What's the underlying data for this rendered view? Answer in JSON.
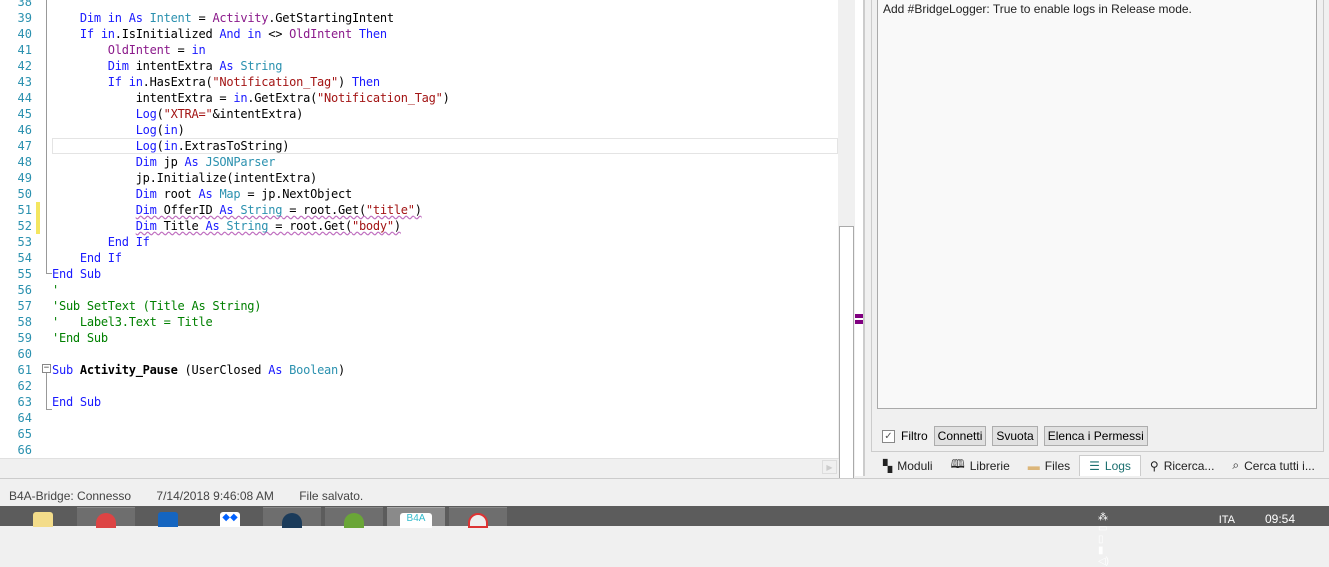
{
  "editor": {
    "lines": [
      {
        "n": "38",
        "seg": []
      },
      {
        "n": "39",
        "seg": [
          [
            "p",
            "    "
          ],
          [
            "kw",
            "Dim in As "
          ],
          [
            "ty",
            "Intent"
          ],
          [
            "p",
            " = "
          ],
          [
            "ob",
            "Activity"
          ],
          [
            "p",
            ".GetStartingIntent"
          ]
        ]
      },
      {
        "n": "40",
        "seg": [
          [
            "p",
            "    "
          ],
          [
            "kw",
            "If in"
          ],
          [
            "p",
            ".IsInitialized "
          ],
          [
            "kw",
            "And in"
          ],
          [
            "p",
            " <> "
          ],
          [
            "ob",
            "OldIntent"
          ],
          [
            "kw",
            " Then"
          ]
        ]
      },
      {
        "n": "41",
        "seg": [
          [
            "p",
            "        "
          ],
          [
            "ob",
            "OldIntent"
          ],
          [
            "p",
            " = "
          ],
          [
            "kw",
            "in"
          ]
        ]
      },
      {
        "n": "42",
        "seg": [
          [
            "p",
            "        "
          ],
          [
            "kw",
            "Dim"
          ],
          [
            "p",
            " intentExtra "
          ],
          [
            "kw",
            "As "
          ],
          [
            "ty",
            "String"
          ]
        ]
      },
      {
        "n": "43",
        "seg": [
          [
            "p",
            "        "
          ],
          [
            "kw",
            "If in"
          ],
          [
            "p",
            ".HasExtra("
          ],
          [
            "st",
            "\"Notification_Tag\""
          ],
          [
            "p",
            ") "
          ],
          [
            "kw",
            "Then"
          ]
        ]
      },
      {
        "n": "44",
        "seg": [
          [
            "p",
            "            intentExtra = "
          ],
          [
            "kw",
            "in"
          ],
          [
            "p",
            ".GetExtra("
          ],
          [
            "st",
            "\"Notification_Tag\""
          ],
          [
            "p",
            ")"
          ]
        ]
      },
      {
        "n": "45",
        "seg": [
          [
            "p",
            "            "
          ],
          [
            "kw",
            "Log"
          ],
          [
            "p",
            "("
          ],
          [
            "st",
            "\"XTRA=\""
          ],
          [
            "p",
            "&intentExtra)"
          ]
        ]
      },
      {
        "n": "46",
        "seg": [
          [
            "p",
            "            "
          ],
          [
            "kw",
            "Log"
          ],
          [
            "p",
            "("
          ],
          [
            "kw",
            "in"
          ],
          [
            "p",
            ")"
          ]
        ]
      },
      {
        "n": "47",
        "seg": [
          [
            "p",
            "            "
          ],
          [
            "kw",
            "Log"
          ],
          [
            "p",
            "("
          ],
          [
            "kw",
            "in"
          ],
          [
            "p",
            ".ExtrasToString)"
          ]
        ]
      },
      {
        "n": "48",
        "seg": [
          [
            "p",
            "            "
          ],
          [
            "kw",
            "Dim"
          ],
          [
            "p",
            " jp "
          ],
          [
            "kw",
            "As "
          ],
          [
            "ty",
            "JSONParser"
          ]
        ]
      },
      {
        "n": "49",
        "seg": [
          [
            "p",
            "            jp.Initialize(intentExtra)"
          ]
        ]
      },
      {
        "n": "50",
        "seg": [
          [
            "p",
            "            "
          ],
          [
            "kw",
            "Dim"
          ],
          [
            "p",
            " root "
          ],
          [
            "kw",
            "As "
          ],
          [
            "ty",
            "Map"
          ],
          [
            "p",
            " = jp.NextObject"
          ]
        ]
      },
      {
        "n": "51",
        "sq": true,
        "seg": [
          [
            "p",
            "            "
          ],
          [
            "kw",
            "Dim"
          ],
          [
            "p",
            " OfferID "
          ],
          [
            "kw",
            "As "
          ],
          [
            "ty",
            "String"
          ],
          [
            "p",
            " = root.Get("
          ],
          [
            "st",
            "\"title\""
          ],
          [
            "p",
            ")"
          ]
        ]
      },
      {
        "n": "52",
        "sq": true,
        "seg": [
          [
            "p",
            "            "
          ],
          [
            "kw",
            "Dim"
          ],
          [
            "p",
            " Title "
          ],
          [
            "kw",
            "As "
          ],
          [
            "ty",
            "String"
          ],
          [
            "p",
            " = root.Get("
          ],
          [
            "st",
            "\"body\""
          ],
          [
            "p",
            ")"
          ]
        ]
      },
      {
        "n": "53",
        "seg": [
          [
            "p",
            "        "
          ],
          [
            "kw",
            "End If"
          ]
        ]
      },
      {
        "n": "54",
        "seg": [
          [
            "p",
            "    "
          ],
          [
            "kw",
            "End If"
          ]
        ]
      },
      {
        "n": "55",
        "seg": [
          [
            "kw",
            "End Sub"
          ]
        ]
      },
      {
        "n": "56",
        "seg": [
          [
            "cm",
            "'"
          ]
        ]
      },
      {
        "n": "57",
        "seg": [
          [
            "cm",
            "'Sub SetText (Title As String)"
          ]
        ]
      },
      {
        "n": "58",
        "seg": [
          [
            "cm",
            "'   Label3.Text = Title"
          ]
        ]
      },
      {
        "n": "59",
        "seg": [
          [
            "cm",
            "'End Sub"
          ]
        ]
      },
      {
        "n": "60",
        "seg": []
      },
      {
        "n": "61",
        "seg": [
          [
            "kw",
            "Sub "
          ],
          [
            "bd",
            "Activity_Pause"
          ],
          [
            "p",
            " (UserClosed "
          ],
          [
            "kw",
            "As "
          ],
          [
            "ty",
            "Boolean"
          ],
          [
            "p",
            ")"
          ]
        ]
      },
      {
        "n": "62",
        "seg": []
      },
      {
        "n": "63",
        "seg": [
          [
            "kw",
            "End Sub"
          ]
        ]
      },
      {
        "n": "64",
        "seg": []
      },
      {
        "n": "65",
        "seg": []
      },
      {
        "n": "66",
        "seg": []
      }
    ]
  },
  "logs": {
    "message": "Add #BridgeLogger: True to enable logs in Release mode.",
    "filter_label": "Filtro",
    "filter_checked": true,
    "connect": "Connetti",
    "clear": "Svuota",
    "permissions": "Elenca i Permessi"
  },
  "tabs": [
    {
      "label": "Moduli",
      "icon": "modules-icon"
    },
    {
      "label": "Librerie",
      "icon": "book-icon"
    },
    {
      "label": "Files",
      "icon": "folder-icon"
    },
    {
      "label": "Logs",
      "icon": "logs-icon",
      "active": true
    },
    {
      "label": "Ricerca...",
      "icon": "search-icon"
    },
    {
      "label": "Cerca tutti i...",
      "icon": "find-all-icon"
    }
  ],
  "status": {
    "bridge": "B4A-Bridge: Connesso",
    "timestamp": "7/14/2018 9:46:08 AM",
    "message": "File salvato."
  },
  "taskbar": {
    "b4a_label": "B4A",
    "language": "ITA",
    "time": "09:54"
  },
  "colors": {
    "keyword": "#1a1aff",
    "type": "#2b91af",
    "string": "#a31515",
    "comment": "#008000",
    "marker": "#800080"
  }
}
